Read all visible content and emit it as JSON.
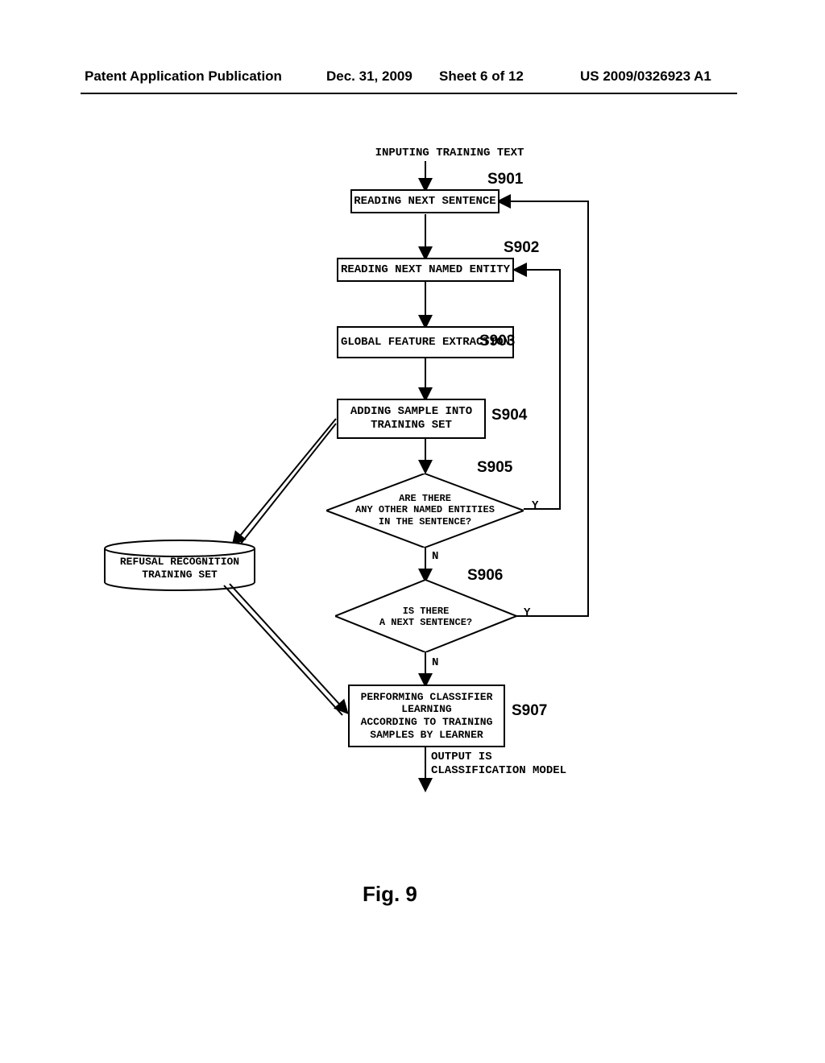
{
  "header": {
    "pub": "Patent Application Publication",
    "date": "Dec. 31, 2009",
    "sheet": "Sheet 6 of 12",
    "appnum": "US 2009/0326923 A1"
  },
  "labels": {
    "input": "INPUTING TRAINING TEXT",
    "output": "OUTPUT IS\nCLASSIFICATION MODEL"
  },
  "boxes": {
    "s901": "READING NEXT SENTENCE",
    "s902": "READING NEXT NAMED ENTITY",
    "s903": "GLOBAL FEATURE EXTRACTION",
    "s904": "ADDING SAMPLE INTO\nTRAINING SET",
    "s907": "PERFORMING CLASSIFIER\nLEARNING\nACCORDING TO TRAINING\nSAMPLES BY LEARNER"
  },
  "diamonds": {
    "s905": "ARE THERE\nANY OTHER NAMED ENTITIES\nIN THE SENTENCE?",
    "s906": "IS THERE\nA NEXT SENTENCE?"
  },
  "cylinder": {
    "refusal": "REFUSAL RECOGNITION\nTRAINING SET"
  },
  "steps": {
    "s901": "S901",
    "s902": "S902",
    "s903": "S903",
    "s904": "S904",
    "s905": "S905",
    "s906": "S906",
    "s907": "S907"
  },
  "yn": {
    "y": "Y",
    "n": "N"
  },
  "figure": "Fig. 9"
}
